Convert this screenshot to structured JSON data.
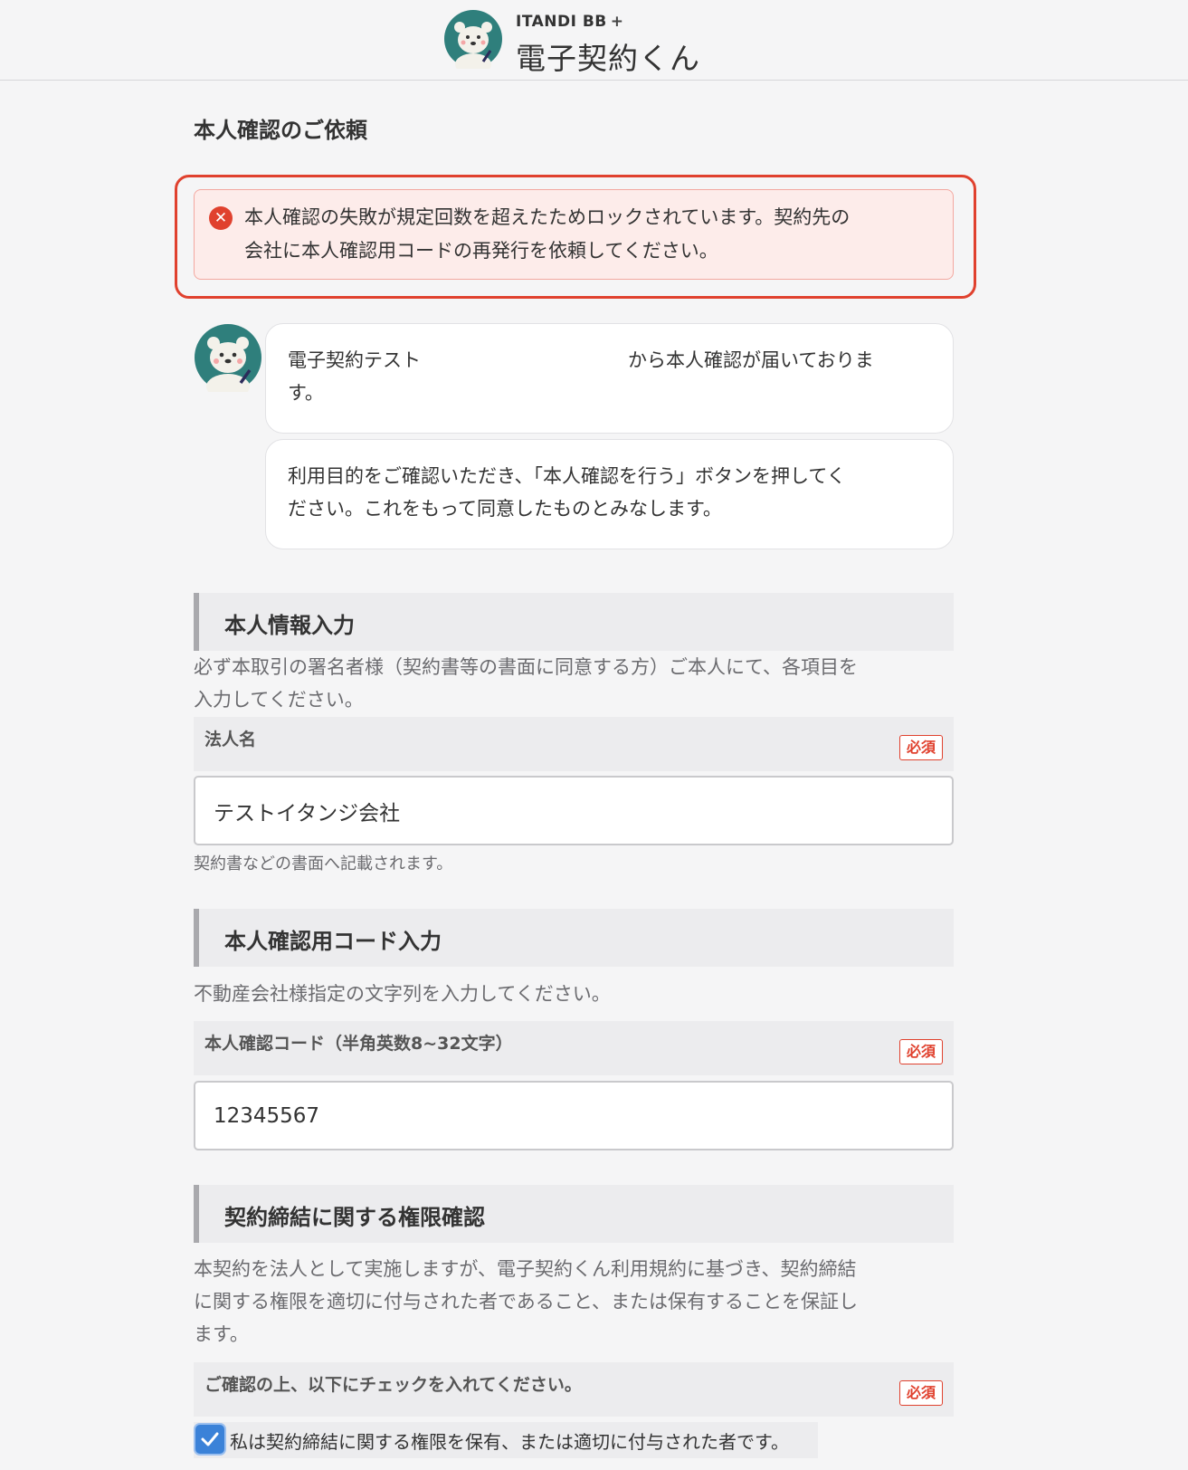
{
  "header": {
    "brand_small": "ITANDI BB",
    "brand_plus": "+",
    "brand_large": "電子契約くん"
  },
  "page_title": "本人確認のご依頼",
  "alert": {
    "line1": "本人確認の失敗が規定回数を超えたためロックされています。契約先の",
    "line2": "会社に本人確認用コードの再発行を依頼してください。",
    "icon": "close-icon"
  },
  "messages": {
    "m1_line1_left": "電子契約テスト",
    "m1_line1_right": "から本人確認が届いておりま",
    "m1_line2": "す。",
    "m2_line1": "利用目的をご確認いただき、「本人確認を行う」ボタンを押してく",
    "m2_line2": "ださい。これをもって同意したものとみなします。"
  },
  "section_personal": {
    "title": "本人情報入力",
    "desc_line1": "必ず本取引の署名者様（契約書等の書面に同意する方）ご本人にて、各項目を",
    "desc_line2": "入力してください。",
    "field_label": "法人名",
    "required": "必須",
    "value": "テストイタンジ会社",
    "hint": "契約書などの書面へ記載されます。"
  },
  "section_code": {
    "title": "本人確認用コード入力",
    "desc": "不動産会社様指定の文字列を入力してください。",
    "field_label": "本人確認コード（半角英数8~32文字）",
    "required": "必須",
    "value": "12345567"
  },
  "section_authority": {
    "title": "契約締結に関する権限確認",
    "desc_line1": "本契約を法人として実施しますが、電子契約くん利用規約に基づき、契約締結",
    "desc_line2": "に関する権限を適切に付与された者であること、または保有することを保証し",
    "desc_line3": "ます。",
    "field_label": "ご確認の上、以下にチェックを入れてください。",
    "required": "必須",
    "checkbox_label": "私は契約締結に関する権限を保有、または適切に付与された者です。",
    "checked": true
  },
  "colors": {
    "accent_red": "#e0412e",
    "checkbox_blue": "#3b82d8",
    "bear_bg": "#2f7f7c"
  }
}
